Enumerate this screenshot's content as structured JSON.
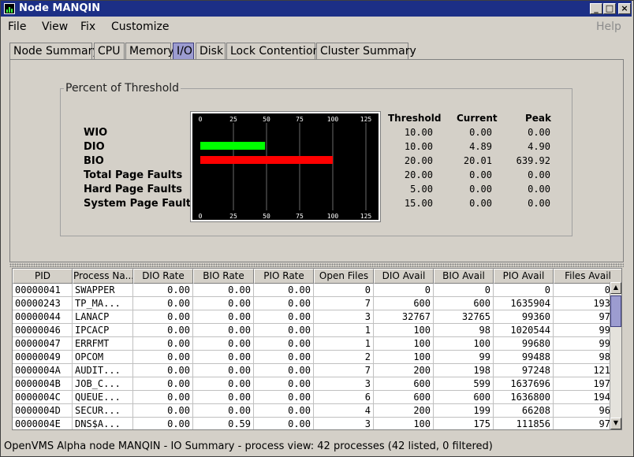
{
  "window": {
    "title": "Node MANQIN"
  },
  "menu": {
    "file": "File",
    "view": "View",
    "fix": "Fix",
    "customize": "Customize",
    "help": "Help"
  },
  "tabs": [
    "Node Summary",
    "CPU",
    "Memory",
    "I/O",
    "Disk",
    "Lock Contention",
    "Cluster Summary"
  ],
  "active_tab": "I/O",
  "group_title": "Percent of Threshold",
  "columns": {
    "threshold": "Threshold",
    "current": "Current",
    "peak": "Peak"
  },
  "metrics": [
    {
      "label": "WIO",
      "threshold": "10.00",
      "current": "0.00",
      "peak": "0.00"
    },
    {
      "label": "DIO",
      "threshold": "10.00",
      "current": "4.89",
      "peak": "4.90"
    },
    {
      "label": "BIO",
      "threshold": "20.00",
      "current": "20.01",
      "peak": "639.92"
    },
    {
      "label": "Total Page Faults",
      "threshold": "20.00",
      "current": "0.00",
      "peak": "0.00"
    },
    {
      "label": "Hard Page Faults",
      "threshold": "5.00",
      "current": "0.00",
      "peak": "0.00"
    },
    {
      "label": "System Page Faults",
      "threshold": "15.00",
      "current": "0.00",
      "peak": "0.00"
    }
  ],
  "chart_data": {
    "type": "bar",
    "categories": [
      "WIO",
      "DIO",
      "BIO",
      "Total Page Faults",
      "Hard Page Faults",
      "System Page Faults"
    ],
    "values": [
      0,
      48.9,
      100,
      0,
      0,
      0
    ],
    "bar_colors": [
      "#00ff00",
      "#00ff00",
      "#ff0000",
      "#00ff00",
      "#00ff00",
      "#00ff00"
    ],
    "xlim": [
      0,
      125
    ],
    "ticks": [
      "0",
      "25",
      "50",
      "75",
      "100",
      "125"
    ],
    "background": "#000000",
    "grid": true
  },
  "table": {
    "headers": [
      "PID",
      "Process Na...",
      "DIO Rate",
      "BIO Rate",
      "PIO Rate",
      "Open Files",
      "DIO Avail",
      "BIO Avail",
      "PIO Avail",
      "Files Avail"
    ],
    "rows": [
      [
        "00000041",
        "SWAPPER",
        "0.00",
        "0.00",
        "0.00",
        "0",
        "0",
        "0",
        "0",
        "0"
      ],
      [
        "00000243",
        "TP_MA...",
        "0.00",
        "0.00",
        "0.00",
        "7",
        "600",
        "600",
        "1635904",
        "193"
      ],
      [
        "00000044",
        "LANACP",
        "0.00",
        "0.00",
        "0.00",
        "3",
        "32767",
        "32765",
        "99360",
        "97"
      ],
      [
        "00000046",
        "IPCACP",
        "0.00",
        "0.00",
        "0.00",
        "1",
        "100",
        "98",
        "1020544",
        "99"
      ],
      [
        "00000047",
        "ERRFMT",
        "0.00",
        "0.00",
        "0.00",
        "1",
        "100",
        "100",
        "99680",
        "99"
      ],
      [
        "00000049",
        "OPCOM",
        "0.00",
        "0.00",
        "0.00",
        "2",
        "100",
        "99",
        "99488",
        "98"
      ],
      [
        "0000004A",
        "AUDIT...",
        "0.00",
        "0.00",
        "0.00",
        "7",
        "200",
        "198",
        "97248",
        "121"
      ],
      [
        "0000004B",
        "JOB_C...",
        "0.00",
        "0.00",
        "0.00",
        "3",
        "600",
        "599",
        "1637696",
        "197"
      ],
      [
        "0000004C",
        "QUEUE...",
        "0.00",
        "0.00",
        "0.00",
        "6",
        "600",
        "600",
        "1636800",
        "194"
      ],
      [
        "0000004D",
        "SECUR...",
        "0.00",
        "0.00",
        "0.00",
        "4",
        "200",
        "199",
        "66208",
        "96"
      ],
      [
        "0000004E",
        "DNS$A...",
        "0.00",
        "0.59",
        "0.00",
        "3",
        "100",
        "175",
        "111856",
        "97"
      ]
    ]
  },
  "status": "OpenVMS Alpha node MANQIN - IO Summary - process view:  42 processes (42 listed, 0 filtered)"
}
